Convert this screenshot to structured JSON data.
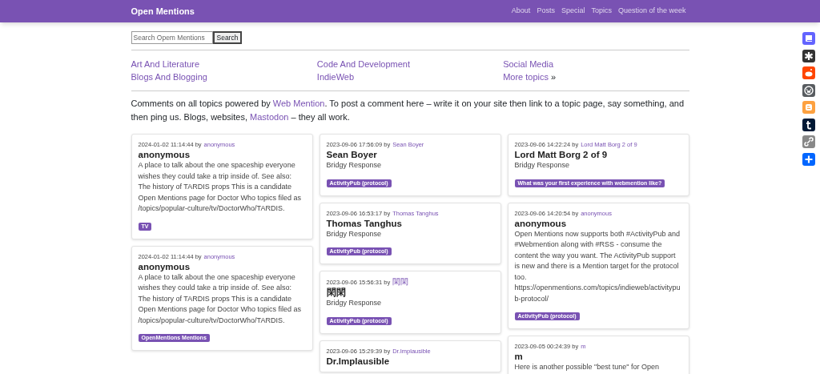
{
  "site_title": "Open Mentions",
  "nav": [
    "About",
    "Posts",
    "Special",
    "Topics",
    "Question of the week"
  ],
  "search": {
    "placeholder": "Search Opem Mentions",
    "button": "Search"
  },
  "topic_columns": [
    [
      {
        "label": "Art And Literature"
      },
      {
        "label": "Blogs And Blogging"
      }
    ],
    [
      {
        "label": "Code And Development"
      },
      {
        "label": "IndieWeb"
      }
    ],
    [
      {
        "label": "Social Media"
      },
      {
        "label": "More topics",
        "suffix": "»"
      }
    ]
  ],
  "intro": [
    {
      "kind": "text",
      "text": "Comments on all topics powered by "
    },
    {
      "kind": "link",
      "text": "Web Mention"
    },
    {
      "kind": "text",
      "text": ". To post a comment here – write it on your site then link to a topic page, say something, and then ping us. Blogs, websites, "
    },
    {
      "kind": "link",
      "text": "Mastodon"
    },
    {
      "kind": "text",
      "text": " – they all work."
    }
  ],
  "columns": [
    [
      {
        "date": "2024-01-02 11:14:44 by",
        "author": "anonymous",
        "title": "anonymous",
        "body": "A place to talk about the one spaceship everyone wishes they could take a trip inside of. See also: The history of TARDIS props This is a candidate Open Mentions page for Doctor Who topics filed as /topics/popular-culture/tv/DoctorWho/TARDIS.",
        "tag": "TV"
      },
      {
        "date": "2024-01-02 11:14:44 by",
        "author": "anonymous",
        "title": "anonymous",
        "body": "A place to talk about the one spaceship everyone wishes they could take a trip inside of. See also: The history of TARDIS props This is a candidate Open Mentions page for Doctor Who topics filed as /topics/popular-culture/tv/DoctorWho/TARDIS.",
        "tag": "OpenMentions Mentions"
      }
    ],
    [
      {
        "date": "2023-09-06 17:56:09 by",
        "author": "Sean Boyer",
        "title": "Sean Boyer",
        "body": "Bridgy Response",
        "tag": "ActivityPub (protocol)"
      },
      {
        "date": "2023-09-06 16:53:17 by",
        "author": "Thomas Tanghus",
        "title": "Thomas Tanghus",
        "body": "Bridgy Response",
        "tag": "ActivityPub (protocol)"
      },
      {
        "date": "2023-09-06 15:56:31 by",
        "author": "閑閑",
        "title": "閑閑",
        "body": "Bridgy Response",
        "tag": "ActivityPub (protocol)"
      },
      {
        "date": "2023-09-06 15:29:39 by",
        "author": "Dr.Implausible",
        "title": "Dr.Implausible"
      }
    ],
    [
      {
        "date": "2023-09-06 14:22:24 by",
        "author": "Lord Matt Borg 2 of 9",
        "title": "Lord Matt Borg 2 of 9",
        "body": "Bridgy Response",
        "tag": "What was your first experience with webmention like?"
      },
      {
        "date": "2023-09-06 14:20:54 by",
        "author": "anonymous",
        "title": "anonymous",
        "body": "Open Mentions now supports both #ActivityPub and #Webmention along with #RSS - consume the content the way you want. The ActivityPub support is new and there is a Mention target for the protocol too. https://openmentions.com/topics/indieweb/activitypub-protocol/",
        "tag": "ActivityPub (protocol)"
      },
      {
        "date": "2023-09-05 00:24:39 by",
        "author": "m",
        "title": "m",
        "body": "Here is another possible \"best tune\" for Open"
      }
    ]
  ]
}
